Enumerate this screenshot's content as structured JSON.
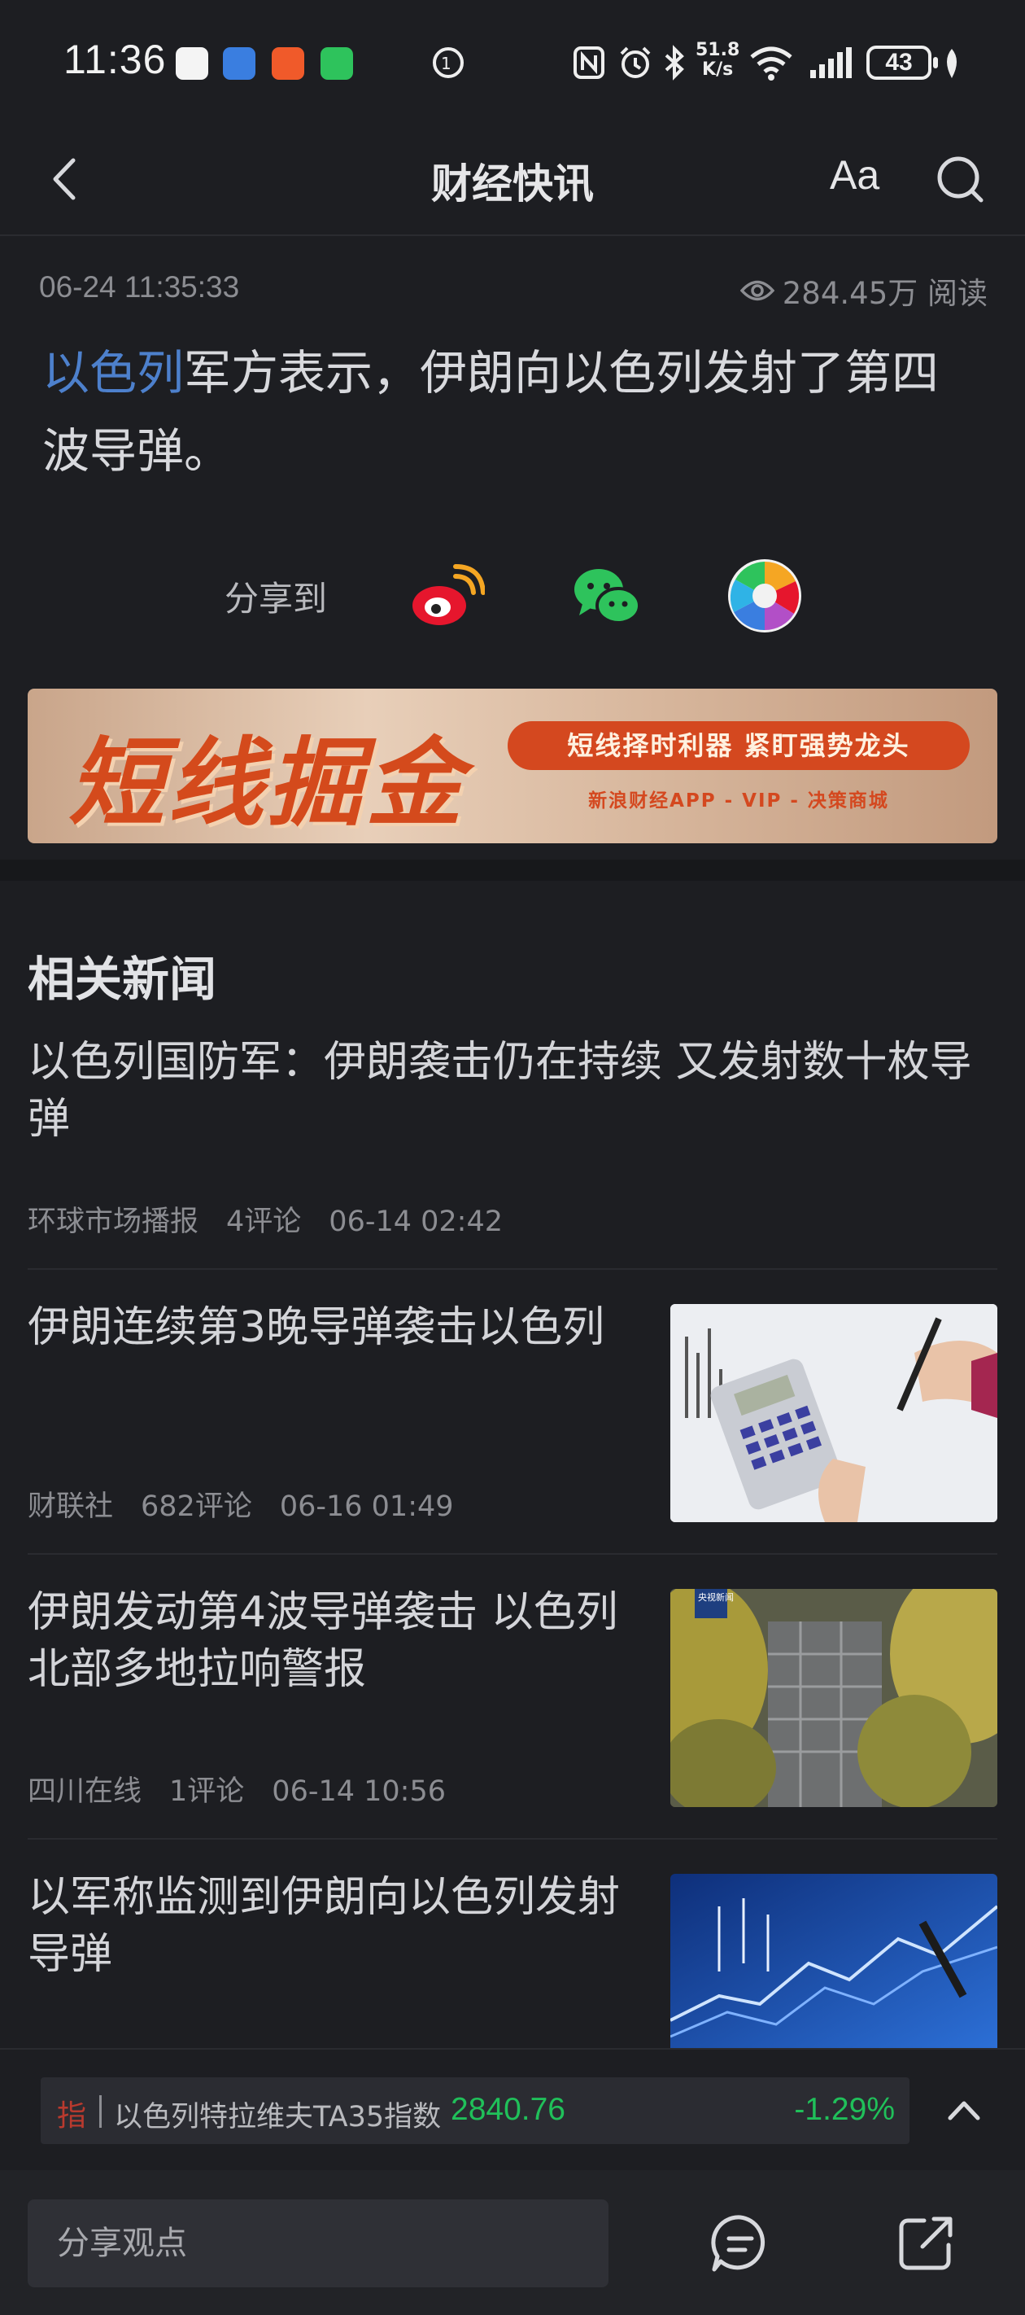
{
  "status_bar": {
    "time": "11:36",
    "net_speed_value": "51.8",
    "net_speed_unit": "K/s",
    "battery": "43"
  },
  "header": {
    "title": "财经快讯",
    "font_button": "Aa"
  },
  "article": {
    "time": "06-24 11:35:33",
    "views": "284.45万 阅读",
    "link_text": "以色列",
    "body_text": "军方表示，伊朗向以色列发射了第四波导弹。"
  },
  "share": {
    "label": "分享到",
    "targets": [
      "weibo-icon",
      "wechat-icon",
      "moments-icon"
    ]
  },
  "banner": {
    "headline": "短线掘金",
    "tagline": "短线择时利器  紧盯强势龙头",
    "subline": "新浪财经APP - VIP - 决策商城"
  },
  "related": {
    "title": "相关新闻",
    "items": [
      {
        "title": "以色列国防军：伊朗袭击仍在持续 又发射数十枚导弹",
        "source": "环球市场播报",
        "comments": "4评论",
        "time": "06-14 02:42"
      },
      {
        "title": "伊朗连续第3晚导弹袭击以色列",
        "source": "财联社",
        "comments": "682评论",
        "time": "06-16 01:49"
      },
      {
        "title": "伊朗发动第4波导弹袭击 以色列北部多地拉响警报",
        "source": "四川在线",
        "comments": "1评论",
        "time": "06-14 10:56",
        "thumb_badge": "央视新闻"
      },
      {
        "title": "以军称监测到伊朗向以色列发射导弹"
      }
    ]
  },
  "ticker": {
    "tag": "指",
    "name": "以色列特拉维夫TA35指数",
    "value": "2840.76",
    "change": "-1.29%",
    "color": "#20c05a"
  },
  "bottom": {
    "placeholder": "分享观点"
  }
}
